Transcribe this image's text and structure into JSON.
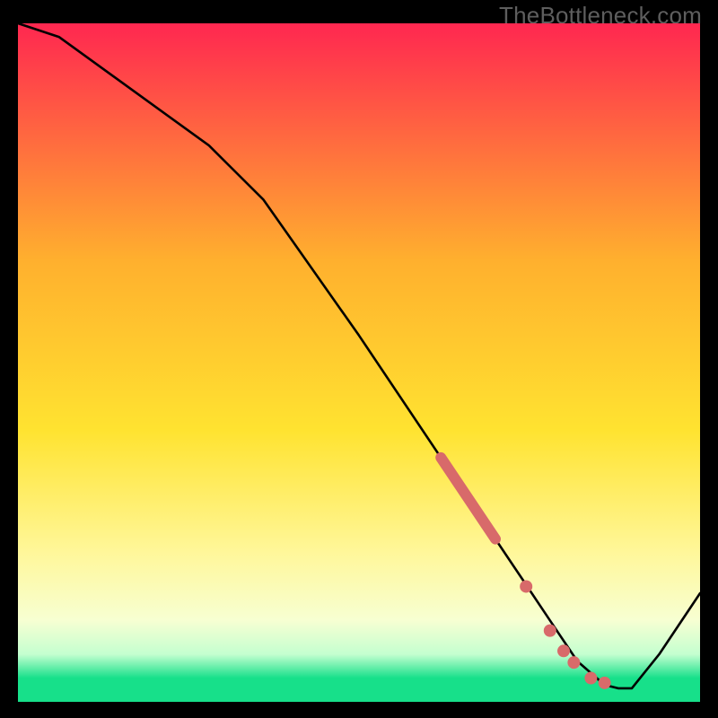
{
  "watermark": "TheBottleneck.com",
  "colors": {
    "grad_top": "#ff2750",
    "grad_mid_upper": "#ffb02e",
    "grad_mid": "#ffe330",
    "grad_low_yellow": "#fff79a",
    "grad_low_pale": "#f7ffd2",
    "grad_low_mint": "#c4ffd0",
    "grad_green": "#17e08a",
    "curve": "#000000",
    "marker": "#d86a6a"
  },
  "chart_data": {
    "type": "line",
    "title": "",
    "xlabel": "",
    "ylabel": "",
    "xlim": [
      0,
      100
    ],
    "ylim": [
      0,
      100
    ],
    "series": [
      {
        "name": "bottleneck-curve",
        "x": [
          0,
          6,
          28,
          36,
          50,
          62,
          70,
          74,
          78,
          82,
          86,
          88,
          90,
          94,
          100
        ],
        "values": [
          100,
          98,
          82,
          74,
          54,
          36,
          24,
          18,
          12,
          6,
          2.5,
          2,
          2,
          7,
          16
        ]
      }
    ],
    "markers": [
      {
        "name": "highlight-segment",
        "type": "thick-line",
        "x": [
          62,
          70
        ],
        "y": [
          36,
          24
        ]
      },
      {
        "name": "marker-dot-1",
        "type": "dot",
        "x": 74.5,
        "y": 17
      },
      {
        "name": "marker-dot-2",
        "type": "dot",
        "x": 78,
        "y": 10.5
      },
      {
        "name": "marker-dot-3",
        "type": "dot",
        "x": 80,
        "y": 7.5
      },
      {
        "name": "marker-dot-4",
        "type": "dot",
        "x": 81.5,
        "y": 5.8
      },
      {
        "name": "marker-dot-5",
        "type": "dot",
        "x": 84,
        "y": 3.5
      },
      {
        "name": "marker-dot-6",
        "type": "dot",
        "x": 86,
        "y": 2.8
      }
    ]
  }
}
